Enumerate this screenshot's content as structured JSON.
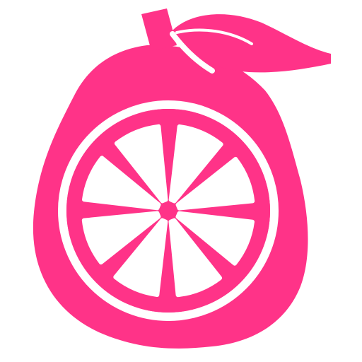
{
  "icon": {
    "name": "grapefruit-icon",
    "fill_color": "#ff3388",
    "background_color": "#ffffff",
    "segment_count": 8
  }
}
